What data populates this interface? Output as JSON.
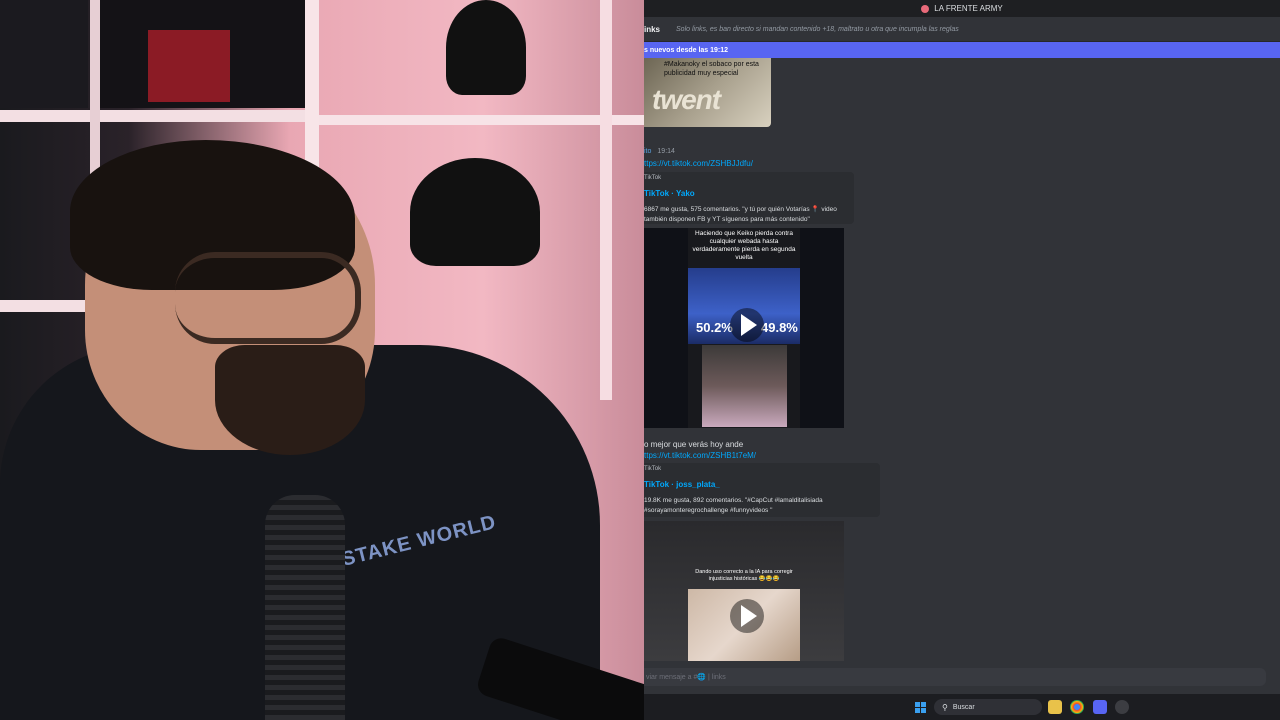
{
  "discord": {
    "server_name": "LA FRENTE ARMY",
    "channel": {
      "name": "inks",
      "topic": "Solo links, es ban directo si mandan contenido +18, maltrato u otra que incumpla las reglas"
    },
    "new_messages_bar": "s nuevos desde las 19:12",
    "image_caption": "#Makanoky el sobaco por esta publicidad muy especial",
    "image_text": "twent",
    "message1": {
      "author": "ito",
      "time": "19:14",
      "link": "ttps://vt.tiktok.com/ZSHBJJdfu/",
      "embed": {
        "provider": "TikTok",
        "title": "TikTok · Yako",
        "description": "6867 me gusta, 575 comentarios. \"y tú por quién Votarías 📍 video también disponen FB y YT síguenos para más contenido\""
      },
      "video": {
        "headline": "Haciendo que Keiko pierda contra cualquier webada hasta verdaderamente pierda en segunda vuelta",
        "left_pct": "50.2%",
        "right_pct": "49.8%"
      }
    },
    "message2": {
      "text": "o mejor que verás hoy ande",
      "link": "ttps://vt.tiktok.com/ZSHB1t7eM/",
      "embed": {
        "provider": "TikTok",
        "title": "TikTok · joss_plata_",
        "description": "19.8K me gusta, 892 comentarios. \"#CapCut #lamalditalisiada #sorayamonteregrochallenge #funnyvideos \""
      },
      "video": {
        "caption": "Dando uso correcto a la IA para corregir injusticias históricas 😂😂😂"
      }
    },
    "composer_placeholder": "viar mensaje a #🌐 | links"
  },
  "taskbar": {
    "search_label": "Buscar"
  },
  "webcam": {
    "shirt_text": "STAKE WORLD"
  },
  "colors": {
    "accent": "#5865f2",
    "link": "#00a8fc",
    "background": "#313338"
  }
}
